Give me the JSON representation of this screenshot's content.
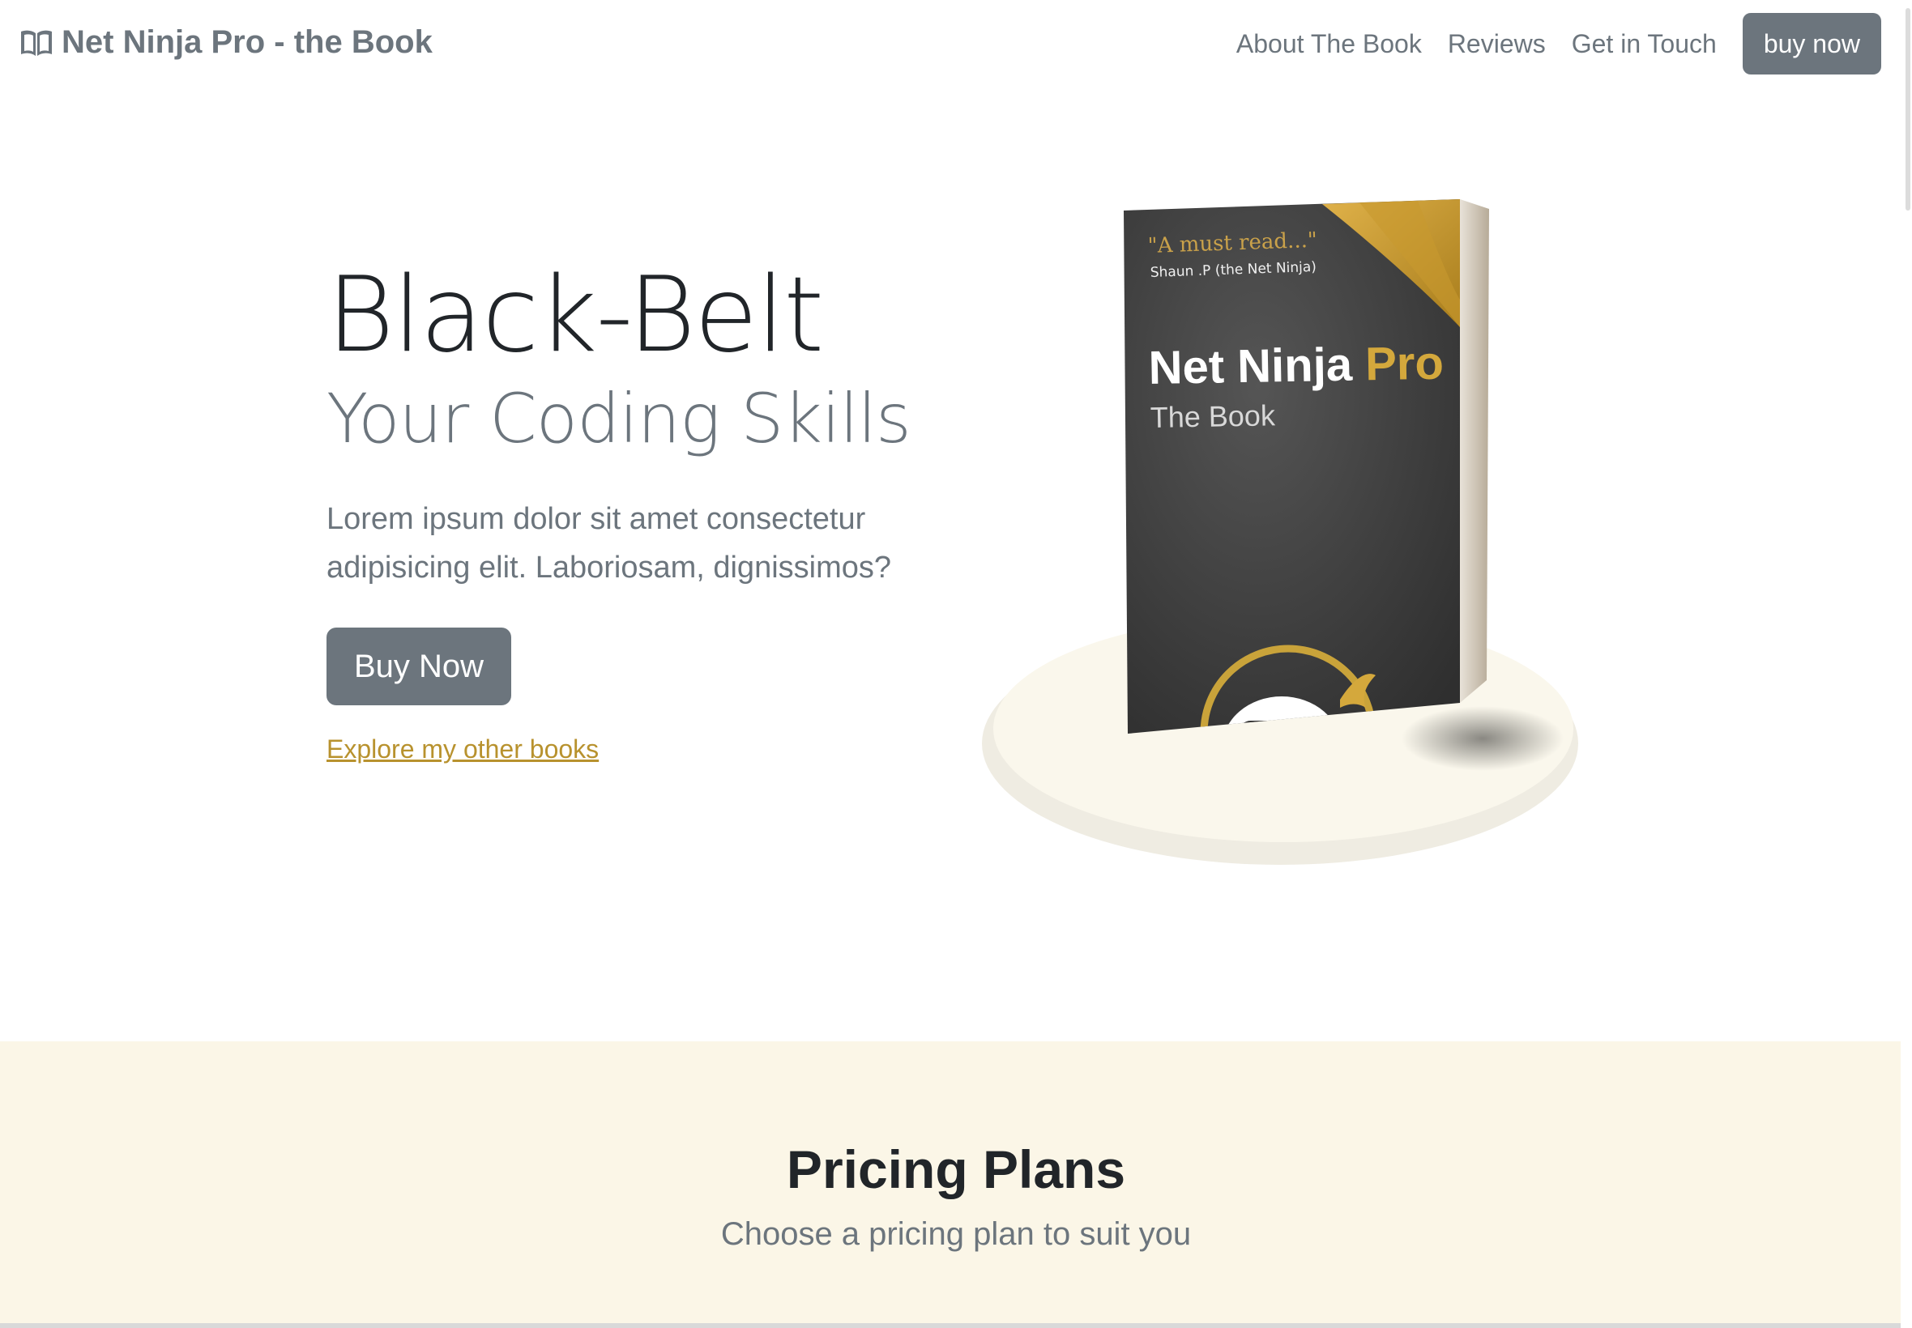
{
  "brand": {
    "title": "Net Ninja Pro - the Book",
    "icon": "book-icon"
  },
  "nav": {
    "links": [
      "About The Book",
      "Reviews",
      "Get in Touch"
    ],
    "cta": "buy now"
  },
  "hero": {
    "title": "Black-Belt",
    "subtitle": "Your Coding Skills",
    "text": "Lorem ipsum dolor sit amet consectetur adipisicing elit. Laboriosam, dignissimos?",
    "buy_label": "Buy Now",
    "link_label": "Explore my other books"
  },
  "book": {
    "quote": "\"A must read...\"",
    "quote_author": "Shaun .P (the Net Ninja)",
    "title_main": "Net Ninja",
    "title_accent": "Pro",
    "title_sub": "The Book"
  },
  "pricing": {
    "title": "Pricing Plans",
    "subtitle": "Choose a pricing plan to suit you"
  },
  "colors": {
    "accent": "#b8922e",
    "secondary": "#6c757d",
    "pricing_bg": "#fbf6e7"
  }
}
